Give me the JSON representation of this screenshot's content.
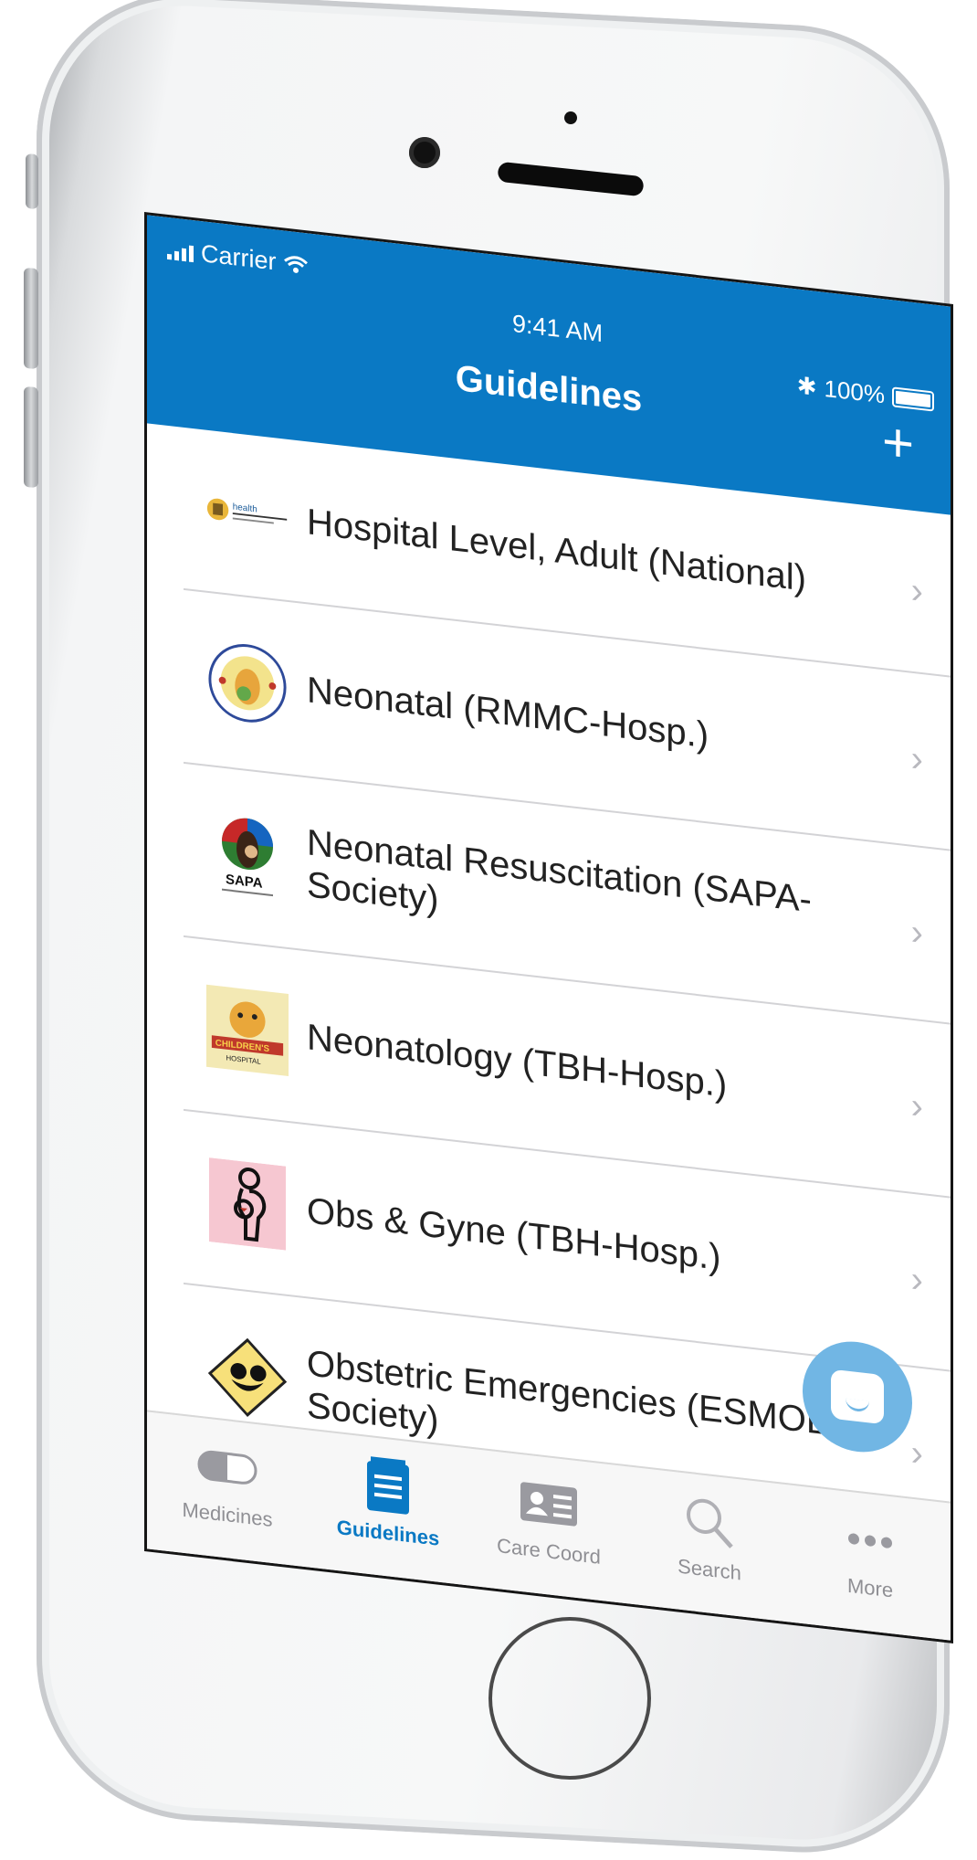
{
  "status": {
    "carrier": "Carrier",
    "time": "9:41 AM",
    "battery": "100%"
  },
  "nav": {
    "title": "Guidelines",
    "add_label": "+"
  },
  "list": [
    {
      "label": "Hospital Level, Adult (National)",
      "logo": "south-africa-health-logo"
    },
    {
      "label": "Neonatal (RMMC-Hosp.)",
      "logo": "rahima-moosa-logo"
    },
    {
      "label": "Neonatal Resuscitation (SAPA-Society)",
      "logo": "sapa-logo"
    },
    {
      "label": "Neonatology (TBH-Hosp.)",
      "logo": "childrens-hospital-logo"
    },
    {
      "label": "Obs & Gyne (TBH-Hosp.)",
      "logo": "pregnant-woman-logo"
    },
    {
      "label": "Obstetric Emergencies (ESMOE-Society)",
      "logo": "esmoe-logo"
    }
  ],
  "tabs": [
    {
      "label": "Medicines",
      "icon": "pill-icon",
      "active": false
    },
    {
      "label": "Guidelines",
      "icon": "document-icon",
      "active": true
    },
    {
      "label": "Care Coord",
      "icon": "id-card-icon",
      "active": false
    },
    {
      "label": "Search",
      "icon": "search-icon",
      "active": false
    },
    {
      "label": "More",
      "icon": "more-icon",
      "active": false
    }
  ],
  "colors": {
    "accent": "#0a79c4",
    "fab": "#71b6e4",
    "inactive": "#8f8f94"
  }
}
